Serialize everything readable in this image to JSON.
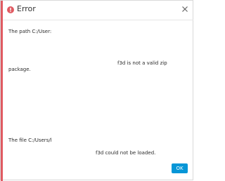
{
  "window": {
    "title": "Error",
    "icon": "error-icon",
    "close_icon": "close-icon"
  },
  "messages": {
    "zip_error_part1": "The path C:/User:",
    "zip_error_part2": "f3d is not a valid zip",
    "zip_error_part3": "package.",
    "load_error_part1": "The file C:/Users/l",
    "load_error_part2": "f3d could not be loaded."
  },
  "buttons": {
    "ok_label": "OK"
  },
  "colors": {
    "accent": "#e05a61",
    "primary": "#0696d7"
  }
}
